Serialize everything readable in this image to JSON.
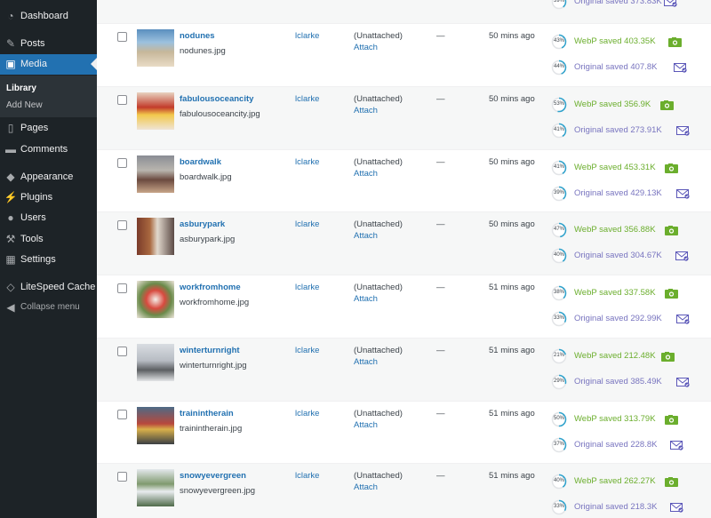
{
  "sidebar": {
    "items": [
      {
        "label": "Dashboard",
        "icon": "dashboard-icon",
        "glyph": "◔"
      },
      {
        "label": "Posts",
        "icon": "pushpin-icon",
        "glyph": "✎"
      },
      {
        "label": "Media",
        "icon": "media-icon",
        "glyph": "▣",
        "active": true
      },
      {
        "label": "Pages",
        "icon": "pages-icon",
        "glyph": "▯"
      },
      {
        "label": "Comments",
        "icon": "comment-icon",
        "glyph": "▬"
      },
      {
        "label": "Appearance",
        "icon": "paintbrush-icon",
        "glyph": "◆"
      },
      {
        "label": "Plugins",
        "icon": "plugin-icon",
        "glyph": "⚡"
      },
      {
        "label": "Users",
        "icon": "users-icon",
        "glyph": "●"
      },
      {
        "label": "Tools",
        "icon": "wrench-icon",
        "glyph": "⚒"
      },
      {
        "label": "Settings",
        "icon": "settings-icon",
        "glyph": "▦"
      },
      {
        "label": "LiteSpeed Cache",
        "icon": "litespeed-icon",
        "glyph": "◇"
      },
      {
        "label": "Collapse menu",
        "icon": "collapse-icon",
        "glyph": "◀"
      }
    ],
    "submenu": [
      "Library",
      "Add New"
    ]
  },
  "top_row": {
    "pct": "39%",
    "text": "Original saved 373.83K"
  },
  "media_rows": [
    {
      "title": "nodunes",
      "file": "nodunes.jpg",
      "author": "lclarke",
      "attached": "(Unattached)",
      "attach_link": "Attach",
      "comments": "—",
      "date": "50 mins ago",
      "webp_pct": "43%",
      "webp": "WebP saved 403.35K",
      "orig_pct": "44%",
      "orig": "Original saved 407.8K",
      "thumb": "beach-photo"
    },
    {
      "title": "fabulousoceancity",
      "file": "fabulousoceancity.jpg",
      "author": "lclarke",
      "attached": "(Unattached)",
      "attach_link": "Attach",
      "comments": "—",
      "date": "50 mins ago",
      "webp_pct": "53%",
      "webp": "WebP saved 356.9K",
      "orig_pct": "41%",
      "orig": "Original saved 273.91K",
      "thumb": "sign-photo"
    },
    {
      "title": "boardwalk",
      "file": "boardwalk.jpg",
      "author": "lclarke",
      "attached": "(Unattached)",
      "attach_link": "Attach",
      "comments": "—",
      "date": "50 mins ago",
      "webp_pct": "41%",
      "webp": "WebP saved 453.31K",
      "orig_pct": "39%",
      "orig": "Original saved 429.13K",
      "thumb": "crowd-photo"
    },
    {
      "title": "asburypark",
      "file": "asburypark.jpg",
      "author": "lclarke",
      "attached": "(Unattached)",
      "attach_link": "Attach",
      "comments": "—",
      "date": "50 mins ago",
      "webp_pct": "47%",
      "webp": "WebP saved 356.88K",
      "orig_pct": "40%",
      "orig": "Original saved 304.67K",
      "thumb": "building-photo"
    },
    {
      "title": "workfromhome",
      "file": "workfromhome.jpg",
      "author": "lclarke",
      "attached": "(Unattached)",
      "attach_link": "Attach",
      "comments": "—",
      "date": "51 mins ago",
      "webp_pct": "38%",
      "webp": "WebP saved 337.58K",
      "orig_pct": "33%",
      "orig": "Original saved 292.99K",
      "thumb": "desk-photo"
    },
    {
      "title": "winterturnright",
      "file": "winterturnright.jpg",
      "author": "lclarke",
      "attached": "(Unattached)",
      "attach_link": "Attach",
      "comments": "—",
      "date": "51 mins ago",
      "webp_pct": "21%",
      "webp": "WebP saved 212.48K",
      "orig_pct": "29%",
      "orig": "Original saved 385.49K",
      "thumb": "winter-road-photo"
    },
    {
      "title": "trainintherain",
      "file": "trainintherain.jpg",
      "author": "lclarke",
      "attached": "(Unattached)",
      "attach_link": "Attach",
      "comments": "—",
      "date": "51 mins ago",
      "webp_pct": "50%",
      "webp": "WebP saved 313.79K",
      "orig_pct": "37%",
      "orig": "Original saved 228.8K",
      "thumb": "rain-photo"
    },
    {
      "title": "snowyevergreen",
      "file": "snowyevergreen.jpg",
      "author": "lclarke",
      "attached": "(Unattached)",
      "attach_link": "Attach",
      "comments": "—",
      "date": "51 mins ago",
      "webp_pct": "40%",
      "webp": "WebP saved 262.27K",
      "orig_pct": "33%",
      "orig": "Original saved 218.3K",
      "thumb": "snow-tree-photo"
    }
  ],
  "colors": {
    "sidebar": "#1d2327",
    "active": "#2271b1",
    "link": "#2271b1",
    "webp": "#6bae2d",
    "original": "#7874bf",
    "ring": "#2ea2cc"
  }
}
